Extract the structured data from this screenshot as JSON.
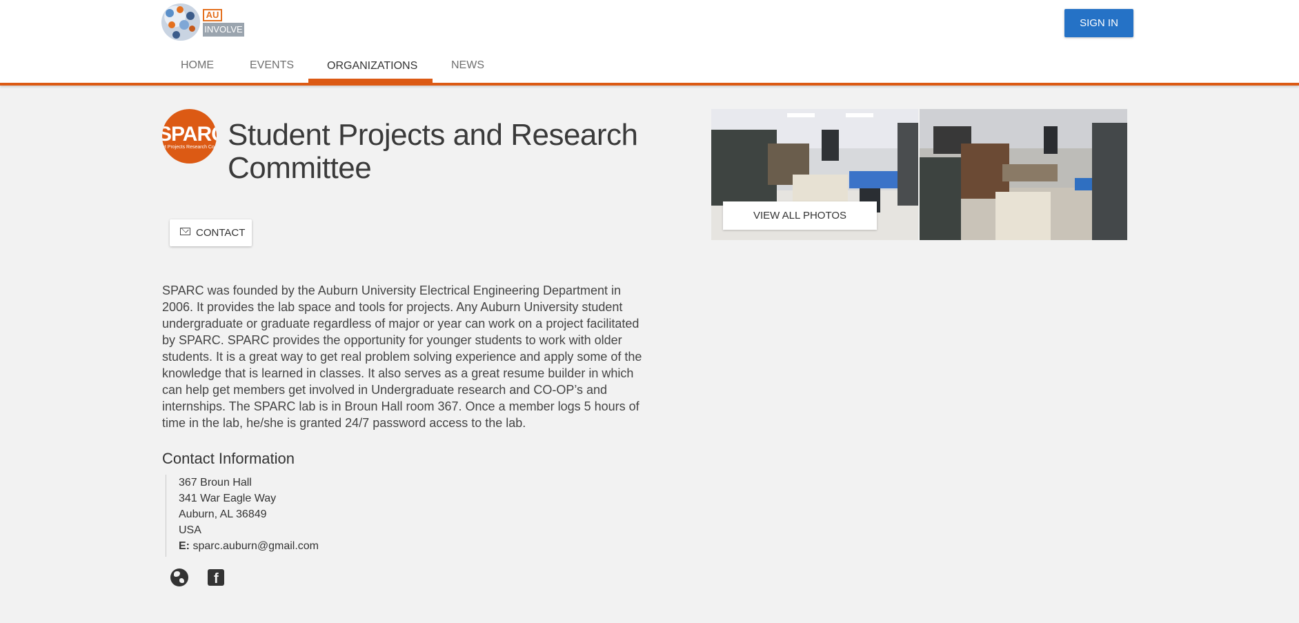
{
  "header": {
    "logo": {
      "badge": "AU",
      "wordmark": "INVOLVE"
    },
    "sign_in_label": "SIGN IN",
    "nav": [
      {
        "label": "HOME",
        "active": false
      },
      {
        "label": "EVENTS",
        "active": false
      },
      {
        "label": "ORGANIZATIONS",
        "active": true
      },
      {
        "label": "NEWS",
        "active": false
      }
    ],
    "accent_color": "#dc5a14",
    "button_color": "#2572c6"
  },
  "organization": {
    "avatar_text": "SPARC",
    "avatar_subtext": "nt Projects    Research Co",
    "title": "Student Projects and Research Committee",
    "contact_label": "CONTACT",
    "view_photos_label": "VIEW ALL PHOTOS",
    "description": "SPARC was founded by the Auburn University Electrical Engineering Department in\n2006.  It provides the lab space and tools for projects.  Any Auburn University student\nundergraduate or graduate regardless of major or year can work on a project facilitated\nby SPARC. SPARC provides the opportunity for younger students to work with older\nstudents. It is a great way to get real problem solving experience and apply some of the\nknowledge that is learned in classes. It also serves as a great resume builder in which\ncan help get members get involved in Undergraduate research and CO-OP’s and\ninternships.  The SPARC lab is in Broun Hall room 367.  Once a member logs 5 hours of\ntime in the lab, he/she is granted 24/7 password access to the lab."
  },
  "contact_info": {
    "heading": "Contact Information",
    "address_lines": [
      "367 Broun Hall",
      "341 War Eagle Way",
      "Auburn, AL 36849",
      "USA"
    ],
    "email_label": "E:",
    "email": "sparc.auburn@gmail.com"
  },
  "social": [
    "globe-icon",
    "facebook-icon"
  ]
}
